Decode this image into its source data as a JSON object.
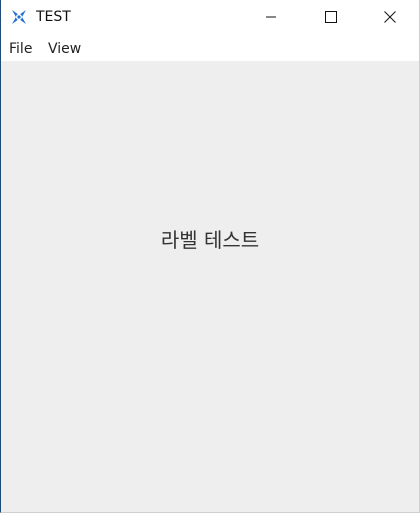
{
  "window": {
    "title": "TEST",
    "icon": "qt-logo-icon",
    "accent_color": "#1e6fd0"
  },
  "titlebar_buttons": {
    "minimize_icon": "minimize-icon",
    "maximize_icon": "maximize-icon",
    "close_icon": "close-icon"
  },
  "menubar": {
    "items": [
      {
        "label": "File"
      },
      {
        "label": "View"
      }
    ]
  },
  "content": {
    "label": "라벨 테스트",
    "background": "#eeeeee"
  }
}
